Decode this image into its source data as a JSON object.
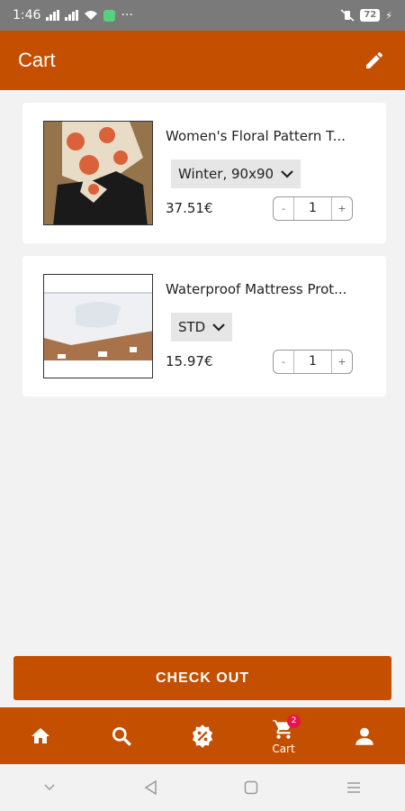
{
  "status_bar": {
    "time": "1:46",
    "battery": "72"
  },
  "app_bar": {
    "title": "Cart"
  },
  "cart_items": [
    {
      "name": "Women's Floral Pattern T...",
      "variant": "Winter, 90x90",
      "price": "37.51€",
      "quantity": "1"
    },
    {
      "name": "Waterproof Mattress Prot...",
      "variant": "STD",
      "price": "15.97€",
      "quantity": "1"
    }
  ],
  "quantity_controls": {
    "minus": "-",
    "plus": "+"
  },
  "checkout_label": "CHECK OUT",
  "bottom_nav": {
    "cart_label": "Cart",
    "cart_badge": "2",
    "items": [
      "home-icon",
      "search-icon",
      "discount-badge-icon",
      "cart-icon",
      "user-icon"
    ]
  },
  "colors": {
    "brand": "#c44f00",
    "badge": "#e8134a",
    "background": "#f2f2f2"
  }
}
